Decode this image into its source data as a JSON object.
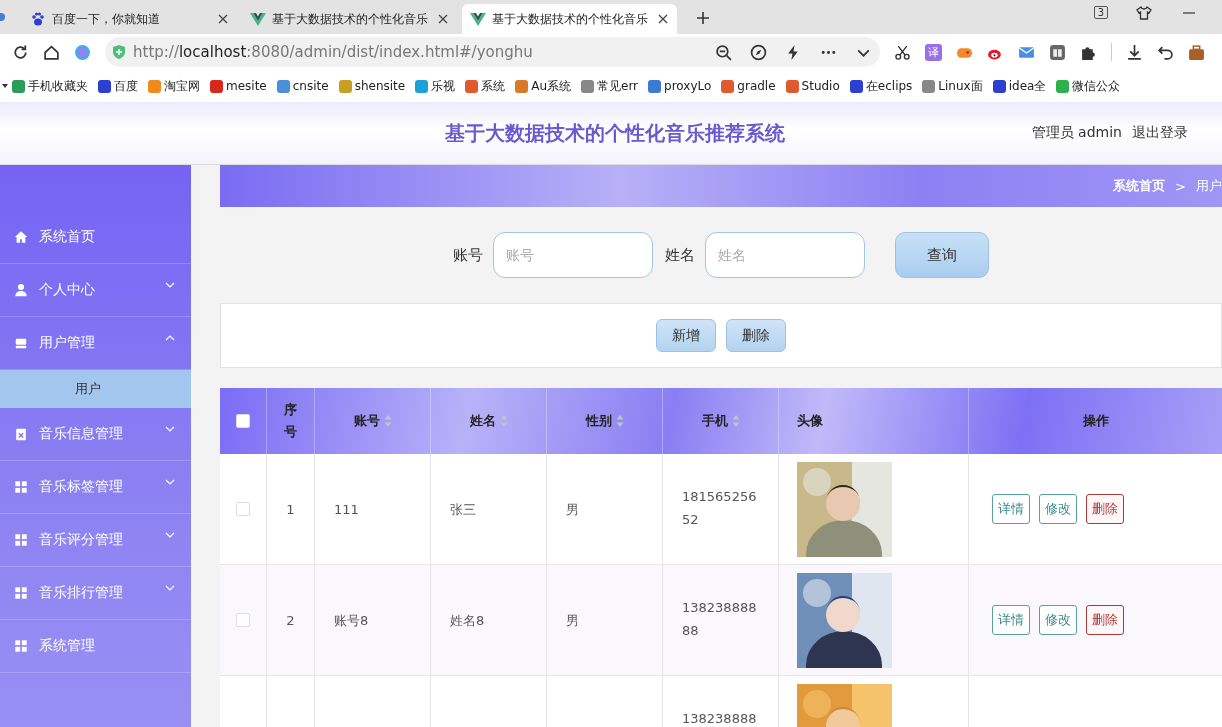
{
  "browser": {
    "tabs": [
      {
        "title": "百度一下，你就知道",
        "selected": false
      },
      {
        "title": "基于大数据技术的个性化音乐",
        "selected": false
      },
      {
        "title": "基于大数据技术的个性化音乐",
        "selected": true
      }
    ],
    "window_badge": "3",
    "url": {
      "host": "localhost",
      "rest": ":8080/admin/dist/index.html#/yonghu",
      "prefix": "http://"
    },
    "translate_glyph": "译",
    "bookmarks": [
      "手机收藏夹",
      "百度",
      "淘宝网",
      "mesite",
      "cnsite",
      "shensite",
      "乐视",
      "系统",
      "Au系统",
      "常见err",
      "proxyLo",
      "gradle",
      "Studio",
      "在eclips",
      "Linux面",
      "idea全",
      "微信公众"
    ]
  },
  "header": {
    "title": "基于大数据技术的个性化音乐推荐系统",
    "user": "管理员 admin",
    "logout": "退出登录"
  },
  "sidebar": {
    "items": [
      {
        "label": "系统首页"
      },
      {
        "label": "个人中心",
        "expanded": false
      },
      {
        "label": "用户管理",
        "expanded": true,
        "children": [
          {
            "label": "用户",
            "selected": true
          }
        ]
      },
      {
        "label": "音乐信息管理",
        "expanded": false
      },
      {
        "label": "音乐标签管理",
        "expanded": false
      },
      {
        "label": "音乐评分管理",
        "expanded": false
      },
      {
        "label": "音乐排行管理",
        "expanded": false
      },
      {
        "label": "系统管理"
      }
    ]
  },
  "breadcrumb": {
    "items": [
      "系统首页",
      "用户"
    ],
    "separator": ">"
  },
  "search": {
    "fields": [
      {
        "label": "账号",
        "placeholder": "账号"
      },
      {
        "label": "姓名",
        "placeholder": "姓名"
      }
    ],
    "button": "查询"
  },
  "actions": [
    "新增",
    "删除"
  ],
  "table": {
    "columns": [
      {
        "label": "序号",
        "sortable": false
      },
      {
        "label": "账号",
        "sortable": true
      },
      {
        "label": "姓名",
        "sortable": true
      },
      {
        "label": "性别",
        "sortable": true
      },
      {
        "label": "手机",
        "sortable": true
      },
      {
        "label": "头像",
        "sortable": false
      },
      {
        "label": "操作",
        "sortable": false
      }
    ],
    "header_checked": false,
    "rows": [
      {
        "checked": false,
        "cells": {
          "no": "1",
          "account": "111",
          "name": "张三",
          "gender": "男",
          "phone": "18156525652"
        },
        "actions": [
          {
            "label": "详情",
            "kind": "detail"
          },
          {
            "label": "修改",
            "kind": "edit"
          },
          {
            "label": "删除",
            "kind": "delete"
          }
        ]
      },
      {
        "checked": false,
        "cells": {
          "no": "2",
          "account": "账号8",
          "name": "姓名8",
          "gender": "男",
          "phone": "13823888888"
        },
        "actions": [
          {
            "label": "详情",
            "kind": "detail"
          },
          {
            "label": "修改",
            "kind": "edit"
          },
          {
            "label": "删除",
            "kind": "delete"
          }
        ]
      },
      {
        "cells": {
          "phone": "138238888"
        }
      }
    ]
  }
}
